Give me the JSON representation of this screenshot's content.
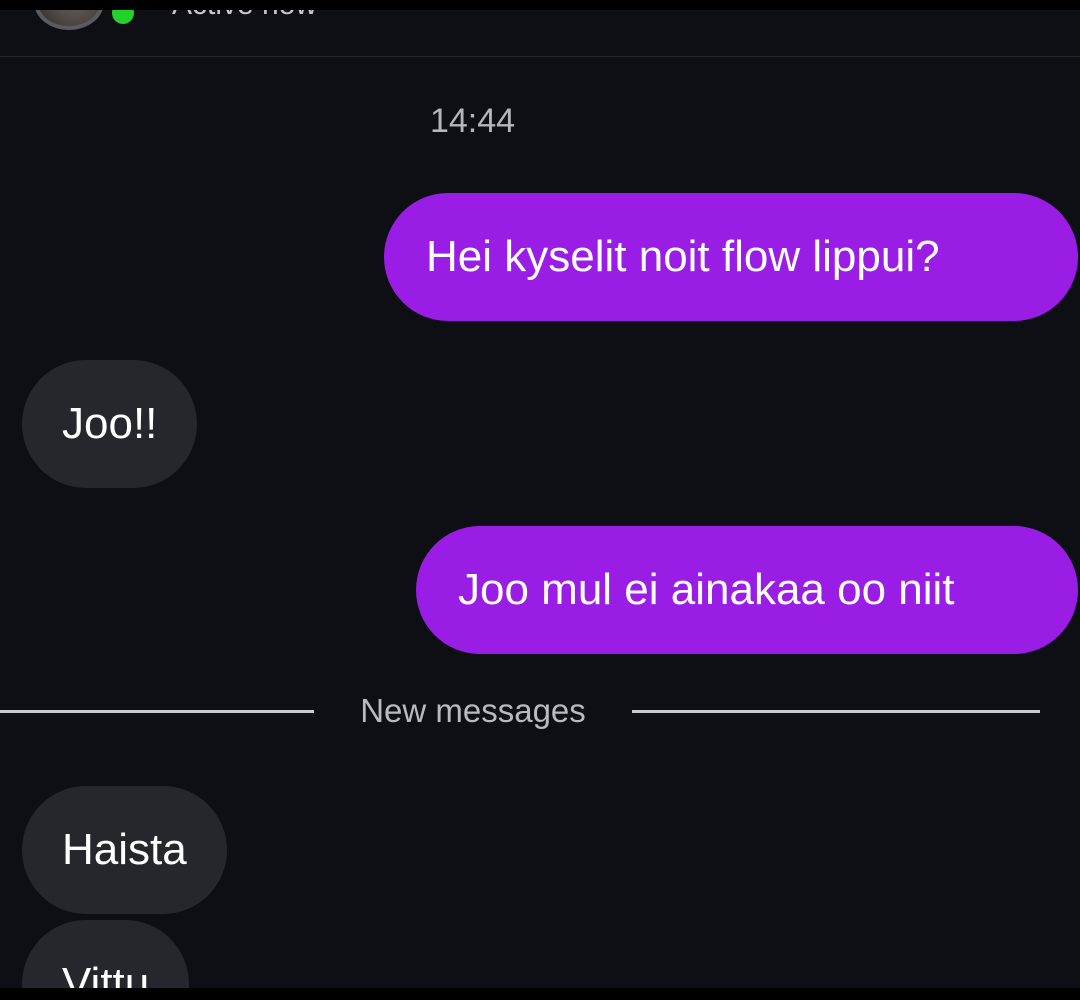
{
  "header": {
    "status_text": "Active now"
  },
  "conversation": {
    "timestamp": "14:44",
    "divider_label": "New messages",
    "messages": [
      {
        "direction": "sent",
        "text": "Hei kyselit noit flow lippui?"
      },
      {
        "direction": "received",
        "text": "Joo!!"
      },
      {
        "direction": "sent",
        "text": "Joo mul ei ainakaa oo niit"
      },
      {
        "direction": "received",
        "text": "Haista"
      },
      {
        "direction": "received",
        "text": "Vittu"
      }
    ]
  },
  "colors": {
    "sent_bubble": "#9a1de6",
    "received_bubble": "#26272d",
    "background": "#0e0f14",
    "online_indicator": "#22d12a"
  }
}
